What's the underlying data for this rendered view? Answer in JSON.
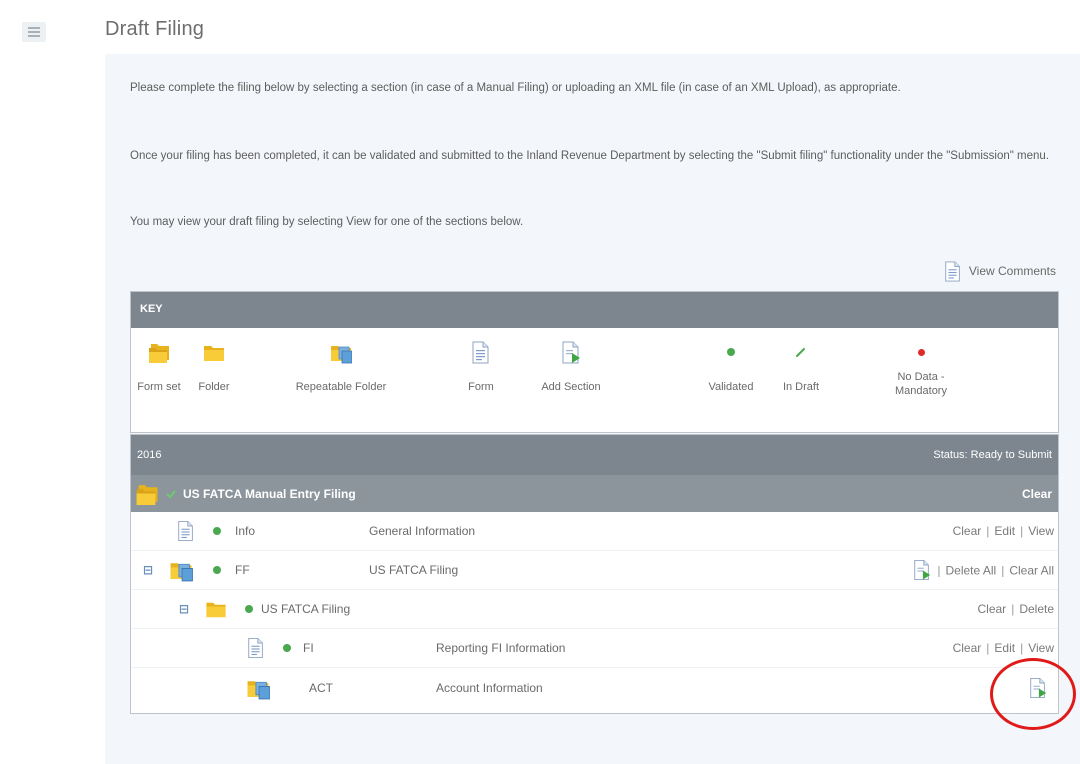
{
  "header": {
    "title": "Draft Filing"
  },
  "intro": {
    "p1": "Please complete the filing below by selecting a section (in case of a Manual Filing) or uploading an XML file (in case of an XML Upload), as appropriate.",
    "p2": "Once your filing has been completed, it can be validated and submitted to the Inland Revenue Department by selecting the \"Submit filing\" functionality under the \"Submission\" menu.",
    "p3": "You may view your draft filing by selecting View for one of the sections below."
  },
  "view_comments": "View Comments",
  "key": {
    "title": "KEY",
    "items": [
      {
        "label": "Form set",
        "icon": "form-set-icon"
      },
      {
        "label": "Folder",
        "icon": "folder-icon"
      },
      {
        "label": "Repeatable Folder",
        "icon": "repeatable-folder-icon"
      },
      {
        "label": "Form",
        "icon": "form-icon"
      },
      {
        "label": "Add Section",
        "icon": "add-section-icon"
      },
      {
        "label": "Validated",
        "icon": "validated-icon"
      },
      {
        "label": "In Draft",
        "icon": "in-draft-icon"
      },
      {
        "label": "No Data - Mandatory",
        "icon": "no-data-mandatory-icon"
      }
    ]
  },
  "tree": {
    "year": "2016",
    "status": "Status: Ready to Submit",
    "filing_title": "US FATCA Manual Entry Filing",
    "filing_action": "Clear",
    "rows": [
      {
        "code": "Info",
        "name": "General Information",
        "a1": "Clear",
        "a2": "Edit",
        "a3": "View"
      },
      {
        "code": "FF",
        "name": "US FATCA Filing",
        "a1": "Delete All",
        "a2": "Clear All"
      },
      {
        "code": "US FATCA Filing",
        "a1": "Clear",
        "a2": "Delete"
      },
      {
        "code": "FI",
        "name": "Reporting FI Information",
        "a1": "Clear",
        "a2": "Edit",
        "a3": "View"
      },
      {
        "code": "ACT",
        "name": "Account Information"
      }
    ]
  },
  "colors": {
    "header_bar": "#7d868f",
    "validated": "#4aa84f",
    "in_draft": "#4aa84f",
    "mandatory": "#e02a2a",
    "highlight": "#e01919"
  }
}
